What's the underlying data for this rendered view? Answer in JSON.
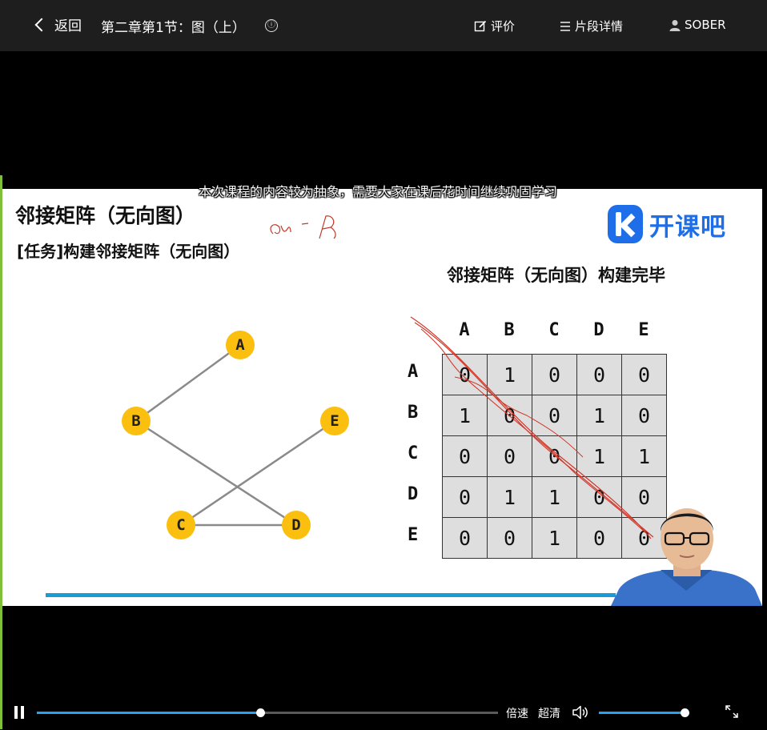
{
  "header": {
    "back_label": "返回",
    "title": "第二章第1节：图（上）",
    "info_icon": "ⓘ",
    "rate_label": "评价",
    "segments_label": "片段详情",
    "user_label": "SOBER"
  },
  "video": {
    "subtitle": "本次课程的内容较为抽象，需要大家在课后花时间继续巩固学习",
    "slide": {
      "title": "邻接矩阵（无向图）",
      "task": "[任务]构建邻接矩阵（无向图）",
      "logo_text": "开课吧",
      "matrix_title": "邻接矩阵（无向图）构建完毕",
      "nodes": [
        "A",
        "B",
        "C",
        "D",
        "E"
      ],
      "edges": [
        [
          "A",
          "B"
        ],
        [
          "B",
          "D"
        ],
        [
          "C",
          "E"
        ],
        [
          "C",
          "D"
        ]
      ],
      "matrix": {
        "columns": [
          "A",
          "B",
          "C",
          "D",
          "E"
        ],
        "rows": [
          "A",
          "B",
          "C",
          "D",
          "E"
        ],
        "values": [
          [
            0,
            1,
            0,
            0,
            0
          ],
          [
            1,
            0,
            0,
            1,
            0
          ],
          [
            0,
            0,
            0,
            1,
            1
          ],
          [
            0,
            1,
            1,
            0,
            0
          ],
          [
            0,
            0,
            1,
            0,
            0
          ]
        ]
      },
      "accent_color": "#1a9ad6",
      "node_color": "#fbbf0f"
    }
  },
  "controls": {
    "speed_label": "倍速",
    "quality_label": "超清",
    "progress": 0.485,
    "volume": 0.97
  }
}
